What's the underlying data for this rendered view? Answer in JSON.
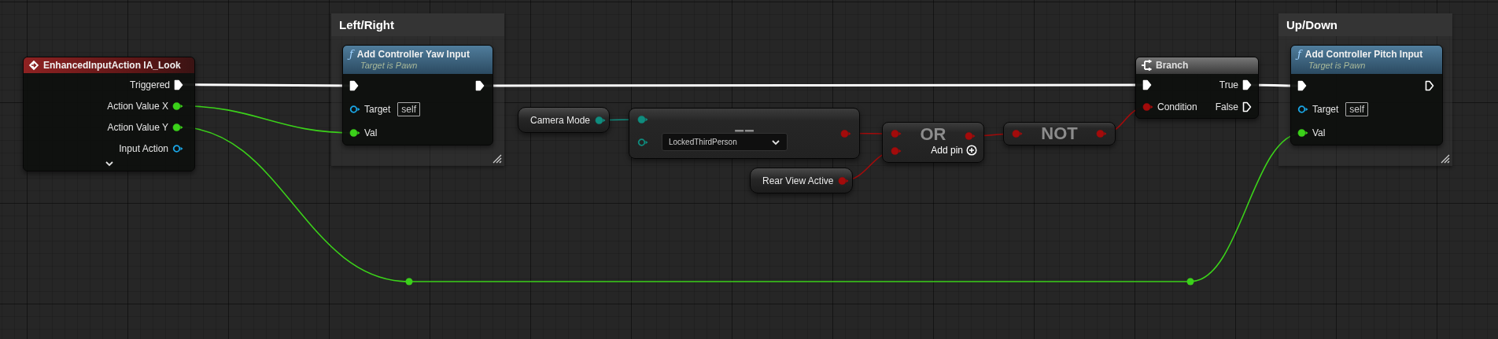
{
  "comments": [
    {
      "title": "Left/Right"
    },
    {
      "title": "Up/Down"
    }
  ],
  "nodes": [
    {
      "kind": "event",
      "title": "EnhancedInputAction IA_Look",
      "expandable": true,
      "outputs": [
        {
          "kind": "exec",
          "label": "Triggered",
          "connected": true
        },
        {
          "kind": "float",
          "label": "Action Value X",
          "connected": true
        },
        {
          "kind": "float",
          "label": "Action Value Y",
          "connected": true
        },
        {
          "kind": "object",
          "label": "Input Action",
          "connected": false
        }
      ]
    },
    {
      "kind": "function",
      "glyph": "ƒ",
      "title": "Add Controller Yaw Input",
      "subtitle": "Target is Pawn",
      "inputs": [
        {
          "kind": "exec",
          "connected": true
        },
        {
          "kind": "object",
          "label": "Target",
          "value": "self",
          "connected": false
        },
        {
          "kind": "float",
          "label": "Val",
          "connected": true
        }
      ],
      "outputs": [
        {
          "kind": "exec",
          "connected": true
        }
      ]
    },
    {
      "kind": "variable",
      "title": "Camera Mode",
      "outputs": [
        {
          "kind": "byte",
          "connected": true
        }
      ]
    },
    {
      "kind": "operator",
      "symbol": "==",
      "inputs": [
        {
          "kind": "byte",
          "connected": true
        },
        {
          "kind": "byte",
          "value": "LockedThirdPerson",
          "connected": false
        }
      ],
      "outputs": [
        {
          "kind": "bool",
          "connected": true
        }
      ]
    },
    {
      "kind": "variable",
      "title": "Rear View Active",
      "outputs": [
        {
          "kind": "bool",
          "connected": true
        }
      ]
    },
    {
      "kind": "operator",
      "symbol": "OR",
      "add_pin": "Add pin",
      "inputs": [
        {
          "kind": "bool",
          "connected": true
        },
        {
          "kind": "bool",
          "connected": true
        }
      ],
      "outputs": [
        {
          "kind": "bool",
          "connected": true
        }
      ]
    },
    {
      "kind": "operator",
      "symbol": "NOT",
      "inputs": [
        {
          "kind": "bool",
          "connected": true
        }
      ],
      "outputs": [
        {
          "kind": "bool",
          "connected": true
        }
      ]
    },
    {
      "kind": "branch",
      "title": "Branch",
      "inputs": [
        {
          "kind": "exec",
          "connected": true
        },
        {
          "kind": "bool",
          "label": "Condition",
          "connected": true
        }
      ],
      "outputs": [
        {
          "kind": "exec",
          "label": "True",
          "connected": true
        },
        {
          "kind": "exec",
          "label": "False",
          "connected": false
        }
      ]
    },
    {
      "kind": "function",
      "glyph": "ƒ",
      "title": "Add Controller Pitch Input",
      "subtitle": "Target is Pawn",
      "inputs": [
        {
          "kind": "exec",
          "connected": true
        },
        {
          "kind": "object",
          "label": "Target",
          "value": "self",
          "connected": false
        },
        {
          "kind": "float",
          "label": "Val",
          "connected": true
        }
      ],
      "outputs": [
        {
          "kind": "exec",
          "connected": false
        }
      ]
    }
  ]
}
